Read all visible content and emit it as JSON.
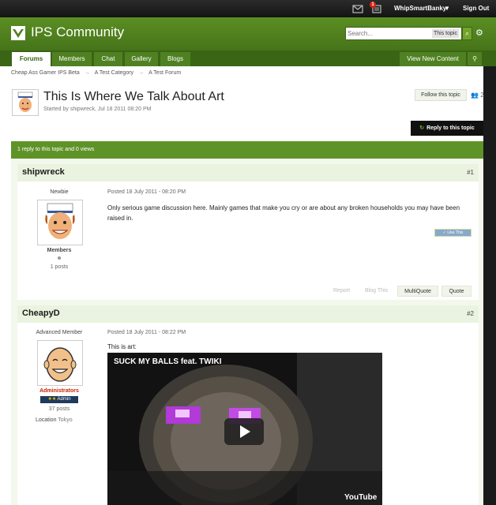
{
  "userbar": {
    "notification_count": "1",
    "username": "WhipSmartBanky",
    "sign_out": "Sign Out"
  },
  "header": {
    "site_name": "IPS Community",
    "search_placeholder": "Search...",
    "search_scope": "This topic"
  },
  "nav": {
    "tabs": [
      {
        "label": "Forums",
        "active": true
      },
      {
        "label": "Members"
      },
      {
        "label": "Chat"
      },
      {
        "label": "Gallery"
      },
      {
        "label": "Blogs"
      }
    ],
    "view_new_content": "View New Content"
  },
  "breadcrumb": [
    "Cheap Ass Gamer IPS Beta",
    "A Test Category",
    "A Test Forum"
  ],
  "topic": {
    "title": "This Is Where We Talk About Art",
    "meta": "Started by shipwreck, Jul 18 2011 08:20 PM",
    "follow_label": "Follow this topic",
    "follower_count": "2",
    "reply_label": "Reply to this topic",
    "stats": "1 reply to this topic and 0 views"
  },
  "posts": [
    {
      "author": "shipwreck",
      "number": "#1",
      "member_title": "Newbie",
      "group": "Members",
      "post_count": "1 posts",
      "date": "Posted 18 July 2011 - 08:20 PM",
      "text": "Only serious game discussion here. Mainly games that make you cry or are about any broken households you may have been raised in.",
      "like_label": "Like This",
      "actions": {
        "report": "Report",
        "blog": "Blog This",
        "multiquote": "MultiQuote",
        "quote": "Quote"
      }
    },
    {
      "author": "CheapyD",
      "number": "#2",
      "member_title": "Advanced Member",
      "group": "Administrators",
      "badge": "Admin",
      "post_count": "37 posts",
      "location_label": "Location",
      "location": "Tokyo",
      "date": "Posted 18 July 2011 - 08:22 PM",
      "text": "This is art:",
      "video_title": "SUCK MY BALLS  feat. TWIKI",
      "video_brand": "YouTube"
    }
  ],
  "colors": {
    "brand_green": "#5b8e23",
    "nav_dark": "#3a6515",
    "admin_red": "#cc2200",
    "admin_badge": "#1e3a5c"
  }
}
